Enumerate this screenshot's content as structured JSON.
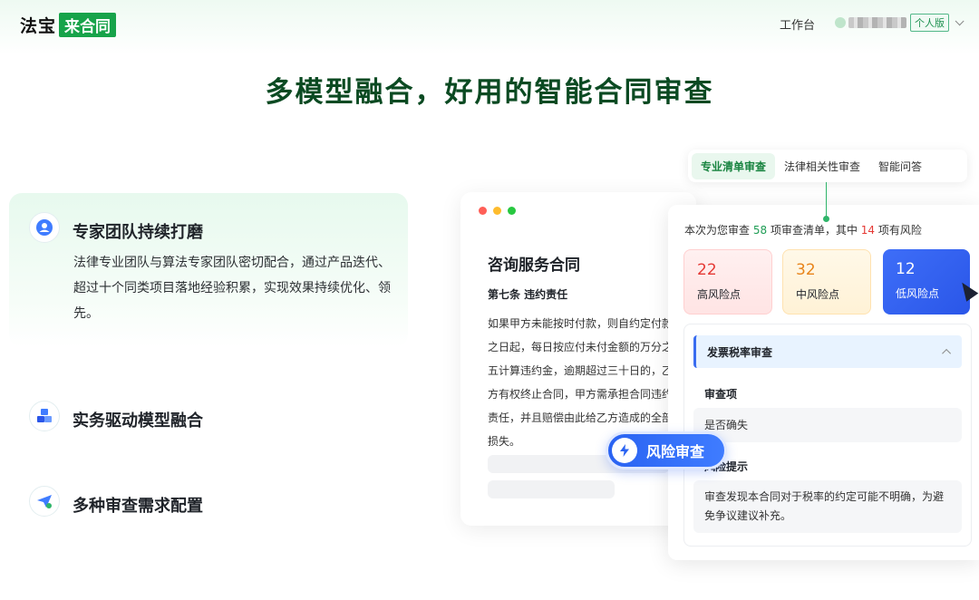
{
  "header": {
    "logo_text": "法宝",
    "logo_badge": "来合同",
    "nav_workbench": "工作台",
    "plan_badge": "个人版"
  },
  "hero": {
    "title": "多模型融合，好用的智能合同审查"
  },
  "features": [
    {
      "title": "专家团队持续打磨",
      "desc": "法律专业团队与算法专家团队密切配合，通过产品迭代、超过十个同类项目落地经验积累，实现效果持续优化、领先。",
      "icon": "user-team-icon"
    },
    {
      "title": "实务驱动模型融合",
      "icon": "cubes-icon"
    },
    {
      "title": "多种审查需求配置",
      "icon": "paper-plane-gear-icon"
    }
  ],
  "doc": {
    "title": "咨询服务合同",
    "section": "第七条 违约责任",
    "lines": [
      "如果甲方未能按时付款，则自约定付款",
      "之日起，每日按应付未付金额的万分之",
      "五计算违约金，逾期超过三十日的，乙",
      "方有权终止合同，甲方需承担合同违约",
      "责任，并且赔偿由此给乙方造成的全部",
      "损失。"
    ]
  },
  "risk_button": {
    "label": "风险审查",
    "icon": "lightning-icon"
  },
  "tabs": [
    {
      "label": "专业清单审查",
      "active": true
    },
    {
      "label": "法律相关性审查",
      "active": false
    },
    {
      "label": "智能问答",
      "active": false
    }
  ],
  "panel": {
    "summary_prefix": "本次为您审查",
    "total_items": "58",
    "summary_middle": "项审查清单，其中",
    "risk_items": "14",
    "summary_suffix": "项有风险",
    "stats": [
      {
        "value": "22",
        "label": "高风险点"
      },
      {
        "value": "32",
        "label": "中风险点"
      },
      {
        "value": "12",
        "label": "低风险点"
      }
    ],
    "detail": {
      "head": "发票税率审查",
      "item_label": "审查项",
      "item_value": "是否确失",
      "tip_label": "风险提示",
      "tip_text": "审查发现本合同对于税率的约定可能不明确，为避免争议建议补充。"
    }
  },
  "colors": {
    "brand_green": "#17a34a",
    "title_green": "#0b4a22",
    "high_risk": "#e53935",
    "mid_risk": "#e8841a",
    "low_risk": "#2a56e8",
    "accent_blue": "#3a6df0"
  }
}
